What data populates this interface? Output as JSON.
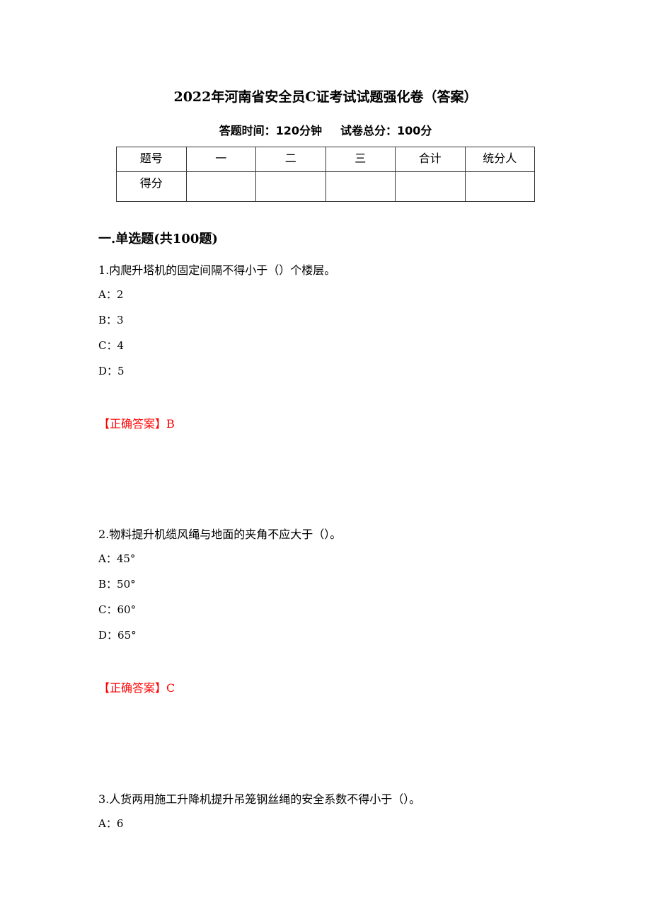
{
  "document": {
    "title": "2022年河南省安全员C证考试试题强化卷（答案）",
    "exam_time_label": "答题时间：120分钟",
    "total_score_label": "试卷总分：100分"
  },
  "score_table": {
    "header": [
      "题号",
      "一",
      "二",
      "三",
      "合计",
      "统分人"
    ],
    "row2_label": "得分",
    "row2_values": [
      "",
      "",
      "",
      "",
      ""
    ]
  },
  "section": {
    "heading": "一.单选题(共100题)"
  },
  "questions": [
    {
      "text": "1.内爬升塔机的固定间隔不得小于（）个楼层。",
      "options": [
        "A：2",
        "B：3",
        "C：4",
        "D：5"
      ],
      "answer": "【正确答案】B"
    },
    {
      "text": "2.物料提升机缆风绳与地面的夹角不应大于（）。",
      "options": [
        "A：45°",
        "B：50°",
        "C：60°",
        "D：65°"
      ],
      "answer": "【正确答案】C"
    },
    {
      "text": "3.人货两用施工升降机提升吊笼钢丝绳的安全系数不得小于（）。",
      "options": [
        "A：6"
      ]
    }
  ],
  "colors": {
    "answer": "#ff0000",
    "text": "#000000"
  }
}
